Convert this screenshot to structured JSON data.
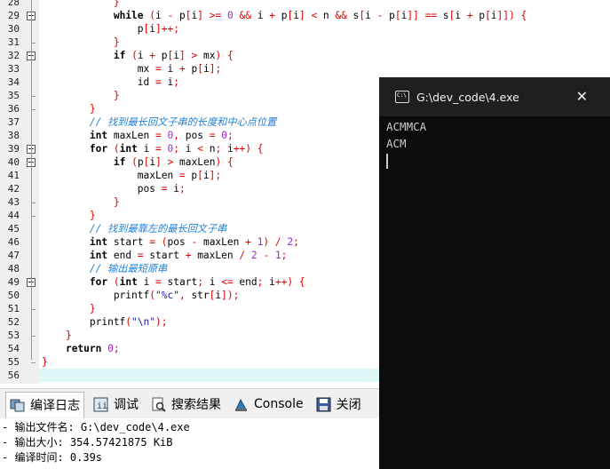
{
  "editor": {
    "lines": [
      {
        "n": "28",
        "t": "            }"
      },
      {
        "n": "29",
        "t": "            while (i - p[i] >= 0 && i + p[i] < n && s[i - p[i]] == s[i + p[i]]) {"
      },
      {
        "n": "30",
        "t": "                p[i]++;"
      },
      {
        "n": "31",
        "t": "            }"
      },
      {
        "n": "32",
        "t": "            if (i + p[i] > mx) {"
      },
      {
        "n": "33",
        "t": "                mx = i + p[i];"
      },
      {
        "n": "34",
        "t": "                id = i;"
      },
      {
        "n": "35",
        "t": "            }"
      },
      {
        "n": "36",
        "t": "        }"
      },
      {
        "n": "37",
        "t": "        // 找到最长回文子串的长度和中心点位置"
      },
      {
        "n": "38",
        "t": "        int maxLen = 0, pos = 0;"
      },
      {
        "n": "39",
        "t": "        for (int i = 0; i < n; i++) {"
      },
      {
        "n": "40",
        "t": "            if (p[i] > maxLen) {"
      },
      {
        "n": "41",
        "t": "                maxLen = p[i];"
      },
      {
        "n": "42",
        "t": "                pos = i;"
      },
      {
        "n": "43",
        "t": "            }"
      },
      {
        "n": "44",
        "t": "        }"
      },
      {
        "n": "45",
        "t": "        // 找到最靠左的最长回文子串"
      },
      {
        "n": "46",
        "t": "        int start = (pos - maxLen + 1) / 2;"
      },
      {
        "n": "47",
        "t": "        int end = start + maxLen / 2 - 1;"
      },
      {
        "n": "48",
        "t": "        // 输出最短原串"
      },
      {
        "n": "49",
        "t": "        for (int i = start; i <= end; i++) {"
      },
      {
        "n": "50",
        "t": "            printf(\"%c\", str[i]);"
      },
      {
        "n": "51",
        "t": "        }"
      },
      {
        "n": "52",
        "t": "        printf(\"\\n\");"
      },
      {
        "n": "53",
        "t": "    }"
      },
      {
        "n": "54",
        "t": "    return 0;"
      },
      {
        "n": "55",
        "t": "}"
      },
      {
        "n": "56",
        "t": ""
      }
    ],
    "active_line": "56"
  },
  "console": {
    "title": "G:\\dev_code\\4.exe",
    "icon_text": "C:\\",
    "close_glyph": "✕",
    "output": [
      "ACMMCA",
      "ACM"
    ]
  },
  "bottom_tabs": [
    {
      "label": "编译日志",
      "icon": "compile-log-icon",
      "selected": true
    },
    {
      "label": "调试",
      "icon": "debug-icon",
      "selected": false
    },
    {
      "label": "搜索结果",
      "icon": "search-results-icon",
      "selected": false
    },
    {
      "label": "Console",
      "icon": "console-icon",
      "selected": false
    },
    {
      "label": "关闭",
      "icon": "close-panel-icon",
      "selected": false
    }
  ],
  "compile_log": [
    "- 输出文件名: G:\\dev_code\\4.exe",
    "- 输出大小: 354.57421875 KiB",
    "- 编译时间: 0.39s"
  ]
}
